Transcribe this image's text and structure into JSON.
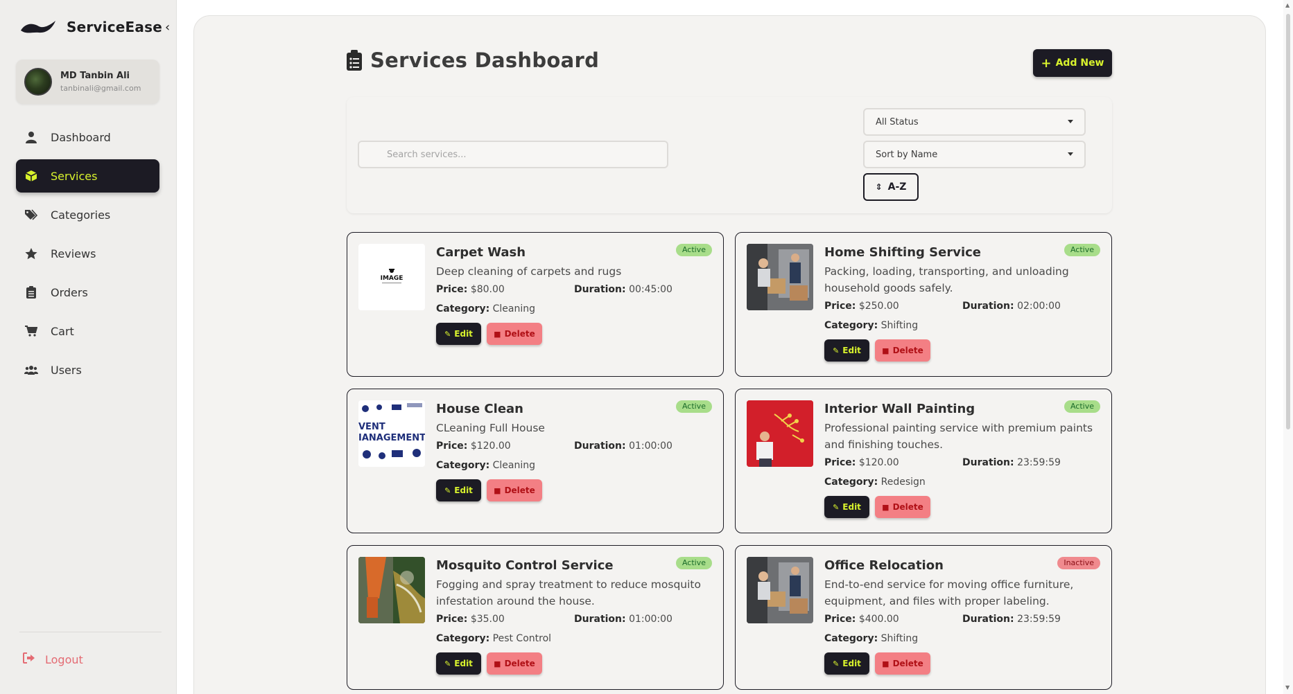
{
  "brand": {
    "name": "ServiceEase",
    "toggle": "‹"
  },
  "profile": {
    "name": "MD Tanbin Ali",
    "email": "tanbinali@gmail.com"
  },
  "nav": [
    {
      "label": "Dashboard",
      "icon": "user-icon"
    },
    {
      "label": "Services",
      "icon": "box-icon",
      "active": true
    },
    {
      "label": "Categories",
      "icon": "tags-icon"
    },
    {
      "label": "Reviews",
      "icon": "star-icon"
    },
    {
      "label": "Orders",
      "icon": "clipboard-icon"
    },
    {
      "label": "Cart",
      "icon": "cart-icon"
    },
    {
      "label": "Users",
      "icon": "users-icon"
    }
  ],
  "logout": {
    "label": "Logout",
    "icon": "logout-icon"
  },
  "header": {
    "title": "Services Dashboard",
    "add_label": "Add New"
  },
  "filters": {
    "search_placeholder": "Search services...",
    "status_selected": "All Status",
    "sort_selected": "Sort by Name",
    "sort_order": "A-Z"
  },
  "labels": {
    "price": "Price:",
    "duration": "Duration:",
    "category": "Category:",
    "edit": "Edit",
    "delete": "Delete"
  },
  "services": [
    {
      "title": "Carpet Wash",
      "description": "Deep cleaning of carpets and rugs",
      "price": "$80.00",
      "duration": "00:45:00",
      "category": "Cleaning",
      "status": "Active"
    },
    {
      "title": "Home Shifting Service",
      "description": "Packing, loading, transporting, and unloading household goods safely.",
      "price": "$250.00",
      "duration": "02:00:00",
      "category": "Shifting",
      "status": "Active"
    },
    {
      "title": "House Clean",
      "description": "CLeaning Full House",
      "price": "$120.00",
      "duration": "01:00:00",
      "category": "Cleaning",
      "status": "Active"
    },
    {
      "title": "Interior Wall Painting",
      "description": "Professional painting service with premium paints and finishing touches.",
      "price": "$120.00",
      "duration": "23:59:59",
      "category": "Redesign",
      "status": "Active"
    },
    {
      "title": "Mosquito Control Service",
      "description": "Fogging and spray treatment to reduce mosquito infestation around the house.",
      "price": "$35.00",
      "duration": "01:00:00",
      "category": "Pest Control",
      "status": "Active"
    },
    {
      "title": "Office Relocation",
      "description": "End-to-end service for moving office furniture, equipment, and files with proper labeling.",
      "price": "$400.00",
      "duration": "23:59:59",
      "category": "Shifting",
      "status": "Inactive"
    }
  ],
  "thumbnail_text": {
    "image_placeholder": "IMAGE",
    "event_1": "VENT",
    "event_2": "IANAGEMENT"
  },
  "colors": {
    "accent": "#d8f22d",
    "dark": "#1c1b24",
    "active_badge": "#a8dd8a",
    "inactive_badge": "#f08a8e",
    "delete": "#f37f84"
  }
}
